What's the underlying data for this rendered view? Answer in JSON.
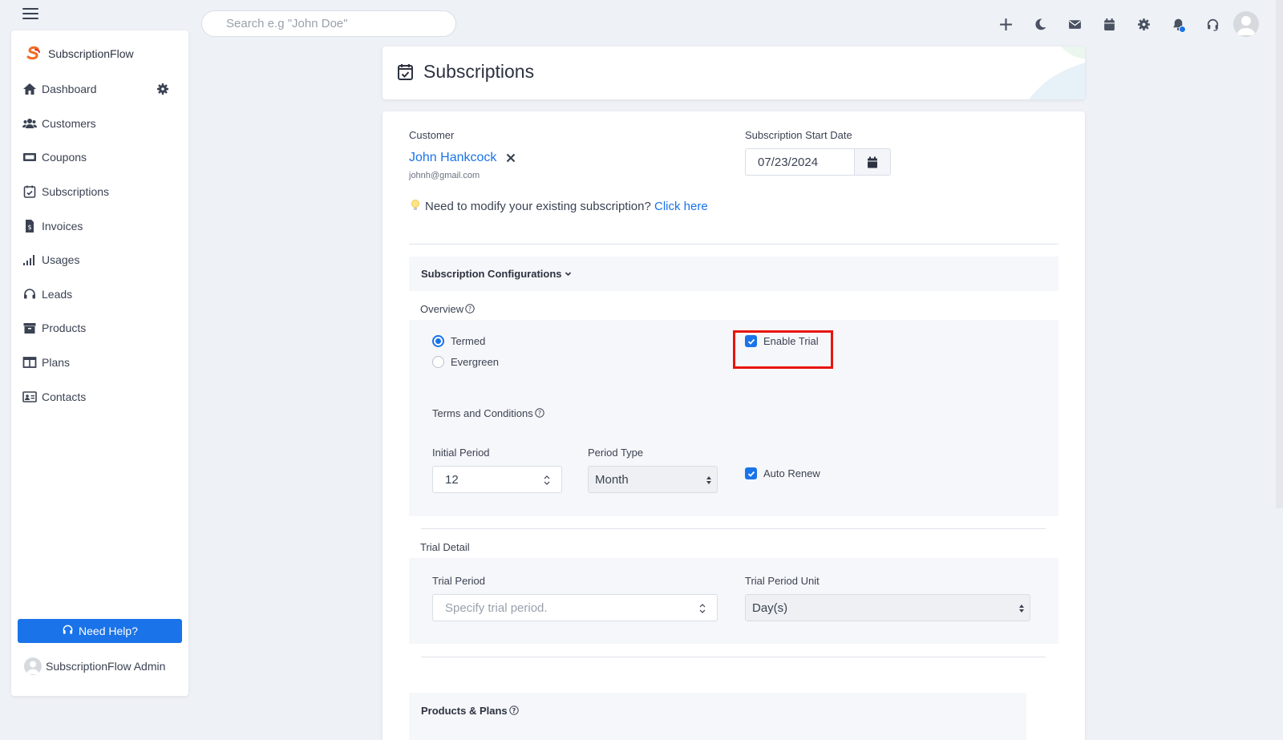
{
  "search": {
    "placeholder": "Search e.g \"John Doe\""
  },
  "topbar": {
    "icons": [
      "plus-icon",
      "moon-icon",
      "envelope-icon",
      "calendar-icon",
      "gear-icon",
      "bell-icon",
      "headset-icon",
      "user-avatar"
    ],
    "accent": "#1a73e8"
  },
  "sidebar": {
    "brand": "SubscriptionFlow",
    "items": [
      {
        "label": "Dashboard",
        "icon": "home-icon"
      },
      {
        "label": "Customers",
        "icon": "users-icon"
      },
      {
        "label": "Coupons",
        "icon": "ticket-icon"
      },
      {
        "label": "Subscriptions",
        "icon": "calendar-check-icon"
      },
      {
        "label": "Invoices",
        "icon": "invoice-icon"
      },
      {
        "label": "Usages",
        "icon": "signal-icon"
      },
      {
        "label": "Leads",
        "icon": "headset-icon"
      },
      {
        "label": "Products",
        "icon": "archive-icon"
      },
      {
        "label": "Plans",
        "icon": "columns-icon"
      },
      {
        "label": "Contacts",
        "icon": "contact-card-icon"
      }
    ],
    "help_label": "Need Help?",
    "admin_name": "SubscriptionFlow Admin"
  },
  "page": {
    "title": "Subscriptions"
  },
  "form": {
    "customer_label": "Customer",
    "customer_name": "John Hankcock",
    "customer_email": "johnh@gmail.com",
    "hint_text": "Need to modify your existing subscription?",
    "hint_link": "Click here",
    "start_date_label": "Subscription Start Date",
    "start_date_value": "07/23/2024",
    "config_title": "Subscription Configurations",
    "overview_label": "Overview",
    "radio_termed": "Termed",
    "radio_evergreen": "Evergreen",
    "selected_type": "Termed",
    "enable_trial_label": "Enable Trial",
    "enable_trial_checked": true,
    "terms_label": "Terms and Conditions",
    "initial_period_label": "Initial Period",
    "initial_period_value": "12",
    "period_type_label": "Period Type",
    "period_type_value": "Month",
    "auto_renew_label": "Auto Renew",
    "auto_renew_checked": true,
    "trial_detail_label": "Trial Detail",
    "trial_period_label": "Trial Period",
    "trial_period_placeholder": "Specify trial period.",
    "trial_unit_label": "Trial Period Unit",
    "trial_unit_value": "Day(s)",
    "products_plans_title": "Products & Plans"
  },
  "colors": {
    "highlight": "#e8150d",
    "link": "#1a73e8",
    "brand_orange": "#f26b21"
  }
}
